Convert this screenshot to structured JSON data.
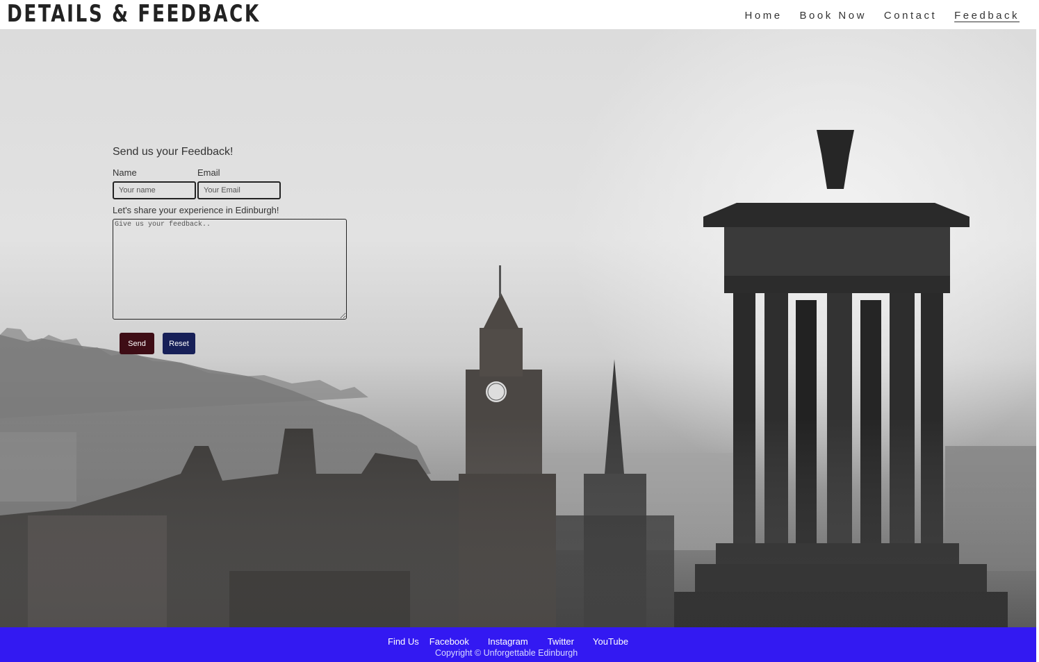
{
  "header": {
    "site_title": "DETAILS & FEEDBACK",
    "nav": [
      {
        "label": "Home",
        "active": false
      },
      {
        "label": "Book Now",
        "active": false
      },
      {
        "label": "Contact",
        "active": false
      },
      {
        "label": "Feedback",
        "active": true
      }
    ]
  },
  "form": {
    "title": "Send us your Feedback!",
    "name_label": "Name",
    "name_placeholder": "Your name",
    "email_label": "Email",
    "email_placeholder": "Your Email",
    "experience_label": "Let's share your experience in Edinburgh!",
    "feedback_placeholder": "Give us your feedback..",
    "send_label": "Send",
    "reset_label": "Reset",
    "send_color": "#3e0d15",
    "reset_color": "#172058"
  },
  "footer": {
    "links": [
      "Find Us",
      "Facebook",
      "Instagram",
      "Twitter",
      "YouTube"
    ],
    "copyright": "Copyright © Unforgettable Edinburgh",
    "background": "#3319f2"
  }
}
